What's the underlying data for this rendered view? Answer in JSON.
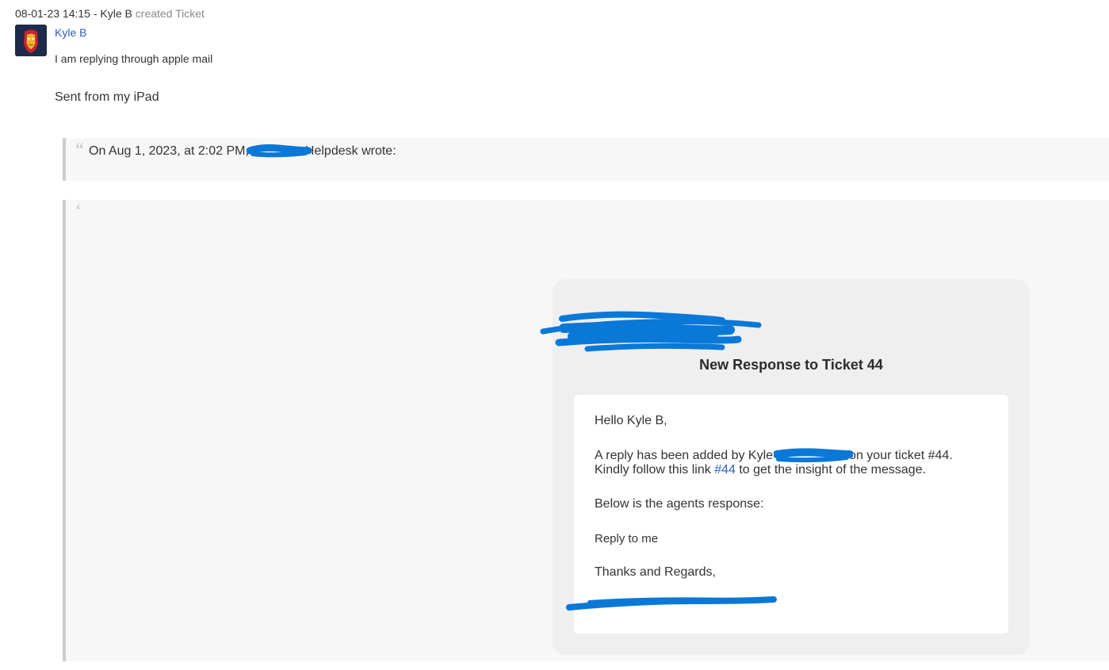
{
  "entry": {
    "timestamp": "08-01-23 14:15",
    "separator": "-",
    "actor": "Kyle B",
    "action": "created Ticket"
  },
  "message": {
    "author": "Kyle B",
    "lines": [
      "I am replying through apple mail",
      "Sent from my iPad"
    ]
  },
  "quote1": {
    "prefix": "On Aug 1, 2023, at 2:02 PM,",
    "suffix": "Helpdesk wrote:"
  },
  "email": {
    "title": "New Response to Ticket 44",
    "greeting": "Hello Kyle B,",
    "reply_prefix": "A reply has been added by Kyle",
    "reply_suffix": "on your ticket #44.",
    "follow_prefix": "Kindly follow this link",
    "follow_link": "#44",
    "follow_suffix": "to get the insight of the message.",
    "below": "Below is the agents response:",
    "response": "Reply to me",
    "thanks": "Thanks and Regards,"
  },
  "colors": {
    "link": "#2d5fb7",
    "redaction": "#0a78d7",
    "quote_bg": "#f7f7f7",
    "quote_border": "#cccccc",
    "card_bg": "#efefef"
  },
  "icons": {
    "avatar": "iron-man-avatar-icon",
    "quote": "quote-mark-icon"
  }
}
